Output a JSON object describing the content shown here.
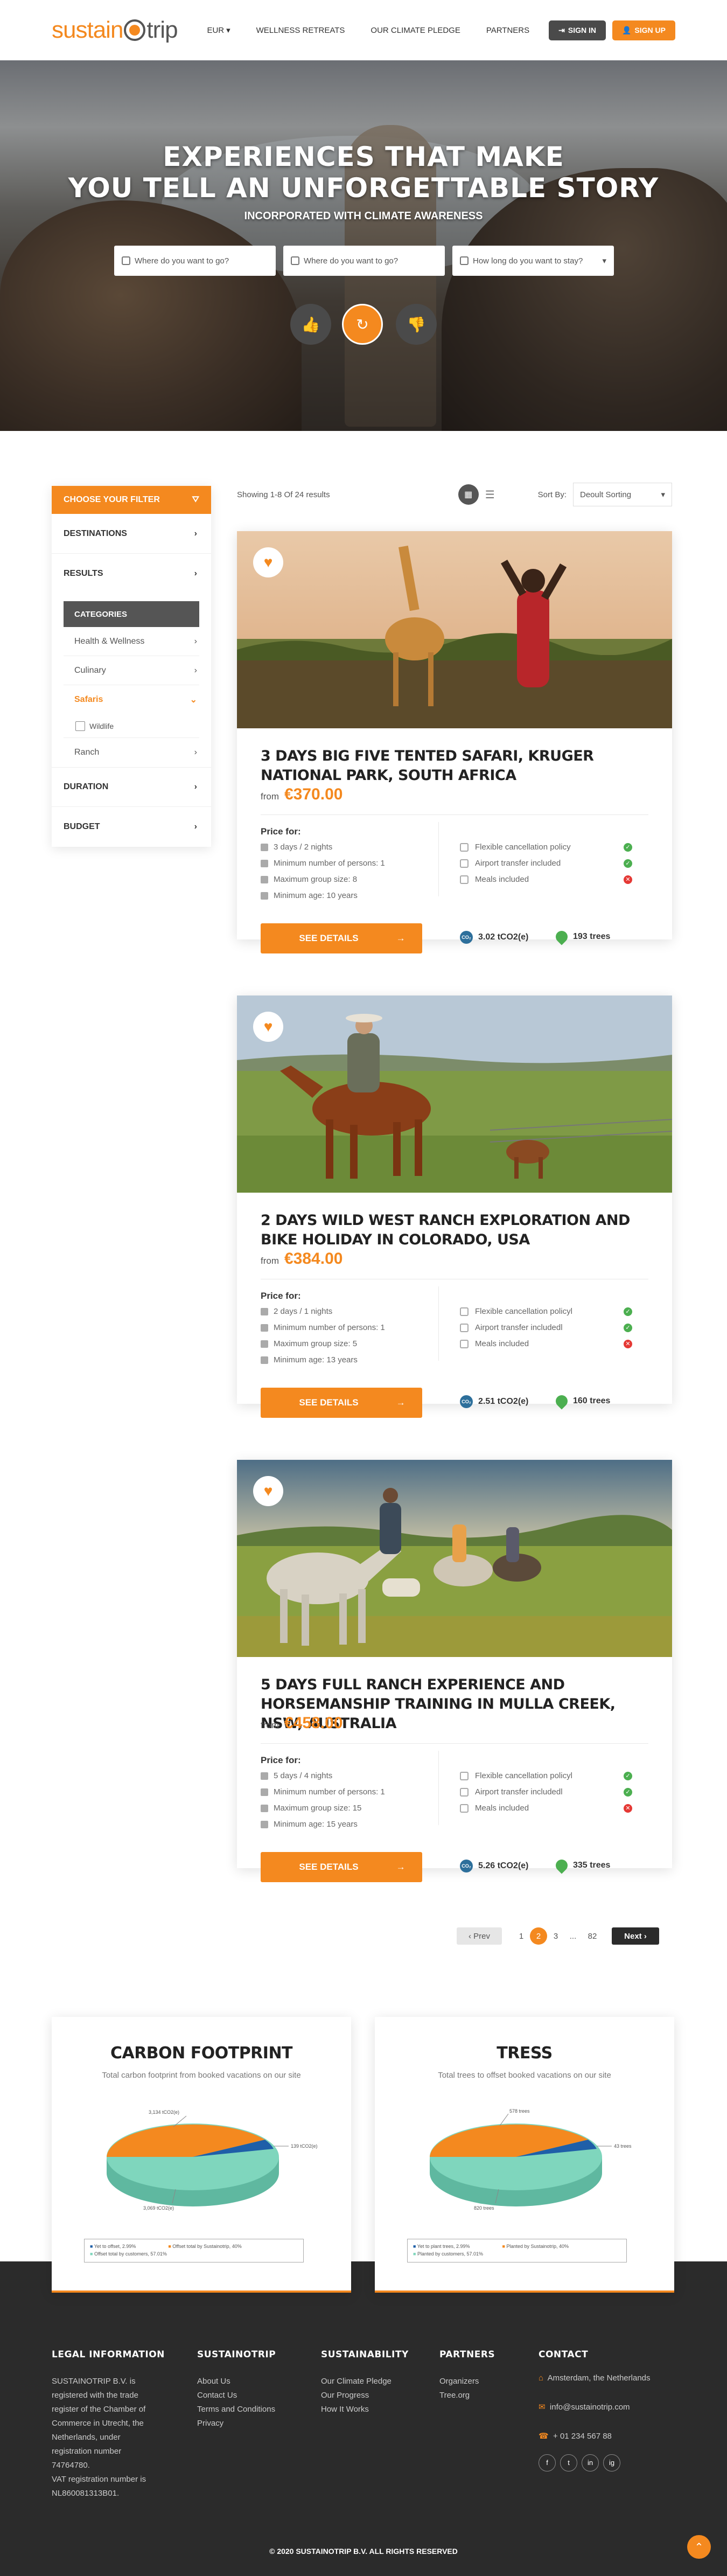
{
  "header": {
    "logo_a": "sustain",
    "logo_b": "trip",
    "currency": "EUR",
    "nav": [
      "WELLNESS RETREATS",
      "OUR CLIMATE PLEDGE",
      "PARTNERS"
    ],
    "signin": "SIGN IN",
    "signup": "SIGN UP"
  },
  "hero": {
    "title_1": "EXPERIENCES THAT MAKE",
    "title_2": "YOU TELL AN UNFORGETTABLE STORY",
    "subtitle": "INCORPORATED WITH CLIMATE AWARENESS",
    "search": [
      {
        "placeholder": "Where do you want to go?",
        "icon": "location-pin-icon"
      },
      {
        "placeholder": "Where do you want to go?",
        "icon": "calendar-icon"
      },
      {
        "placeholder": "How long do you want to stay?",
        "icon": "calendar-icon"
      }
    ]
  },
  "filter": {
    "title": "CHOOSE YOUR FILTER",
    "rows": [
      "DESTINATIONS",
      "RESULTS"
    ],
    "categories_title": "CATEGORIES",
    "categories": [
      "Health & Wellness",
      "Culinary",
      "Safaris"
    ],
    "safaris_sub": "Wildlife",
    "after": [
      "Ranch"
    ],
    "bottom_rows": [
      "DURATION",
      "BUDGET"
    ]
  },
  "results": {
    "showing": "Showing 1-8 Of 24 results",
    "sort_label": "Sort By:",
    "sort_value": "Deoult Sorting"
  },
  "cards": [
    {
      "title": "3 DAYS BIG FIVE TENTED SAFARI, KRUGER NATIONAL PARK, SOUTH AFRICA",
      "from": "from",
      "price": "€370.00",
      "price_for": "Price for:",
      "details": [
        "3 days / 2 nights",
        "Minimum number of persons: 1",
        "Maximum group size: 8",
        "Minimum age: 10 years"
      ],
      "features": [
        {
          "label": "Flexible cancellation policy",
          "ok": true
        },
        {
          "label": "Airport transfer included",
          "ok": true
        },
        {
          "label": "Meals included",
          "ok": false
        }
      ],
      "button": "SEE DETAILS",
      "co2": "3.02 tCO2(e)",
      "trees": "193 trees"
    },
    {
      "title": "2 DAYS WILD WEST RANCH EXPLORATION AND BIKE HOLIDAY IN COLORADO, USA",
      "from": "from",
      "price": "€384.00",
      "price_for": "Price for:",
      "details": [
        "2 days / 1 nights",
        "Minimum number of persons: 1",
        "Maximum group size: 5",
        "Minimum age: 13 years"
      ],
      "features": [
        {
          "label": "Flexible cancellation policyl",
          "ok": true
        },
        {
          "label": "Airport transfer includedl",
          "ok": true
        },
        {
          "label": "Meals included",
          "ok": false
        }
      ],
      "button": "SEE DETAILS",
      "co2": "2.51 tCO2(e)",
      "trees": "160 trees"
    },
    {
      "title": "5 DAYS FULL RANCH EXPERIENCE AND HORSEMANSHIP TRAINING IN MULLA CREEK, NSW, AUSTRALIA",
      "from": "from",
      "price": "€458.00",
      "price_for": "Price for:",
      "details": [
        "5 days / 4 nights",
        "Minimum number of persons: 1",
        "Maximum group size: 15",
        "Minimum age: 15 years"
      ],
      "features": [
        {
          "label": "Flexible cancellation policyl",
          "ok": true
        },
        {
          "label": "Airport transfer includedl",
          "ok": true
        },
        {
          "label": "Meals included",
          "ok": false
        }
      ],
      "button": "SEE DETAILS",
      "co2": "5.26 tCO2(e)",
      "trees": "335 trees"
    }
  ],
  "pager": {
    "prev": "Prev",
    "pages": [
      "1",
      "2",
      "3",
      "...",
      "82"
    ],
    "next": "Next",
    "current": "2"
  },
  "stats": [
    {
      "title": "CARBON FOOTPRINT",
      "sub": "Total carbon footprint from booked vacations on our site",
      "labels": [
        "3,134 tCO2(e)",
        "139 tCO2(e)",
        "3,069 tCO2(e)"
      ],
      "legend": [
        "Yet to offset, 2.99%",
        "Offset total by Sustainotrip, 40%",
        "Offset total by customers, 57.01%"
      ]
    },
    {
      "title": "TRESS",
      "sub": "Total trees to offset booked vacations on our site",
      "labels": [
        "578 trees",
        "43 trees",
        "820 trees"
      ],
      "legend": [
        "Yet to plant trees, 2.99%",
        "Planted by Sustainotrip, 40%",
        "Planted by customers, 57.01%"
      ]
    }
  ],
  "footer": {
    "legal_title": "LEGAL INFORMATION",
    "legal_text": [
      "SUSTAINOTRIP B.V. is",
      "registered with the trade",
      "register of the Chamber of",
      "Commerce in Utrecht, the",
      "Netherlands, under",
      "registration number",
      "74764780.",
      "VAT registration number is",
      "NL860081313B01."
    ],
    "cols": [
      {
        "title": "SUSTAINOTRIP",
        "items": [
          "About Us",
          "Contact Us",
          "Terms and Conditions",
          "Privacy"
        ]
      },
      {
        "title": "SUSTAINABILITY",
        "items": [
          "Our Climate Pledge",
          "Our Progress",
          "How It Works"
        ]
      },
      {
        "title": "PARTNERS",
        "items": [
          "Organizers",
          "Tree.org"
        ]
      }
    ],
    "contact_title": "CONTACT",
    "contact": [
      "Amsterdam, the Netherlands",
      "info@sustainotrip.com",
      "+ 01 234 567 88"
    ],
    "social": [
      "f",
      "t",
      "in",
      "ig"
    ],
    "copyright": "© 2020 SUSTAINOTRIP B.V. ALL RIGHTS RESERVED"
  },
  "colors": {
    "accent": "#f4891f",
    "dark": "#2b2b2b",
    "ok": "#4caf50",
    "no": "#e53935"
  }
}
